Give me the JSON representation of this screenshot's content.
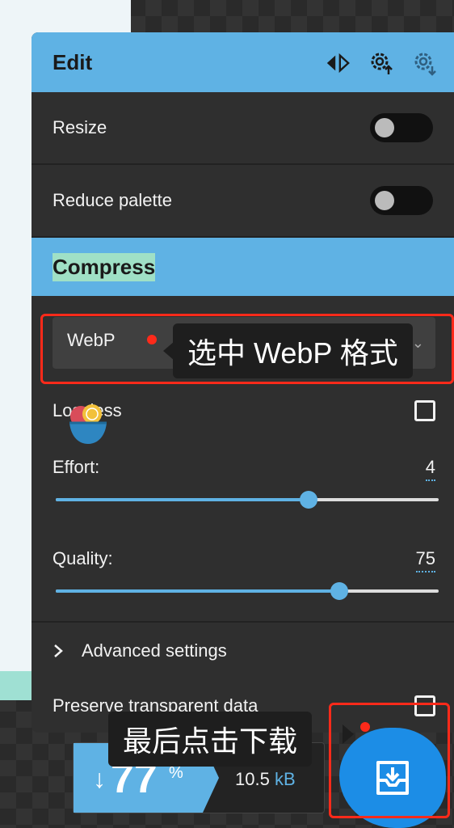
{
  "panel": {
    "title": "Edit",
    "rows": {
      "resize": "Resize",
      "reduce_palette": "Reduce palette"
    },
    "compress_title": "Compress",
    "format_value": "WebP",
    "lossless_label": "Lossless",
    "effort": {
      "label": "Effort:",
      "value": "4",
      "fraction": 0.66
    },
    "quality": {
      "label": "Quality:",
      "value": "75",
      "fraction": 0.74
    },
    "advanced_label": "Advanced settings",
    "preserve_label": "Preserve transparent data"
  },
  "result": {
    "percent": "77",
    "percent_symbol": "%",
    "size": "10.5",
    "unit": "kB"
  },
  "annotations": {
    "select_tip": "选中 WebP 格式",
    "download_tip": "最后点击下载"
  },
  "colors": {
    "accent": "#5fb2e4",
    "highlight": "#9fe0c6",
    "annotation_red": "#ff2a1a"
  },
  "icons": [
    "split-view-icon",
    "settings-upload-icon",
    "settings-download-icon",
    "chevron-down-icon",
    "chevron-right-icon",
    "download-icon"
  ]
}
